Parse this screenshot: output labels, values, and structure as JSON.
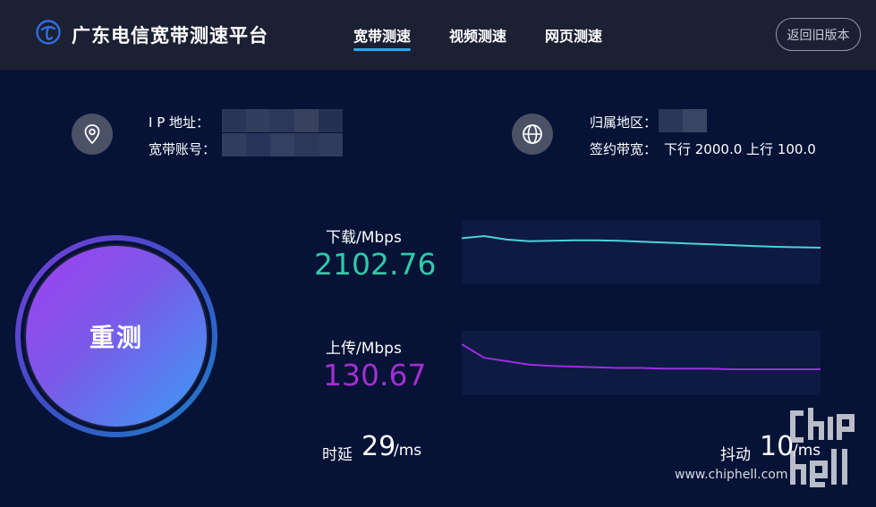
{
  "header": {
    "brand_title": "广东电信宽带测速平台",
    "tabs": [
      {
        "label": "宽带测速",
        "active": true
      },
      {
        "label": "视频测速",
        "active": false
      },
      {
        "label": "网页测速",
        "active": false
      }
    ],
    "old_version_label": "返回旧版本",
    "icons": {
      "logo": "china-telecom-logo-icon"
    }
  },
  "info": {
    "ip_label": "I P  地址：",
    "account_label": "宽带账号：",
    "region_label": "归属地区：",
    "bandwidth_label": "签约带宽：",
    "bandwidth_value": "下行 2000.0 上行 100.0",
    "icons": {
      "location": "location-pin-icon",
      "globe": "globe-icon"
    }
  },
  "retest": {
    "label": "重测"
  },
  "download": {
    "label": "下载/Mbps",
    "value": "2102.76",
    "color": "#2ec9a9",
    "line_color": "#4fd1d9",
    "series": [
      2110,
      2115,
      2107,
      2103,
      2104,
      2105,
      2105,
      2104,
      2102,
      2100,
      2098,
      2096,
      2094,
      2092,
      2090,
      2089,
      2088
    ]
  },
  "upload": {
    "label": "上传/Mbps",
    "value": "130.67",
    "color": "#a22fd0",
    "line_color": "#9a2fe0",
    "series": [
      170,
      150,
      145,
      140,
      138,
      137,
      136,
      135,
      135,
      134,
      134,
      134,
      133,
      133,
      133,
      133,
      133
    ]
  },
  "latency": {
    "label": "时延",
    "value": "29",
    "unit": "/ms"
  },
  "jitter": {
    "label": "抖动",
    "value": "10",
    "unit": "/ms"
  },
  "watermark": {
    "url": "www.chiphell.com"
  },
  "colors": {
    "background": "#061236",
    "header": "#1c2033",
    "chart_bg": "#0d1a42",
    "accent": "#2aa6f0"
  }
}
